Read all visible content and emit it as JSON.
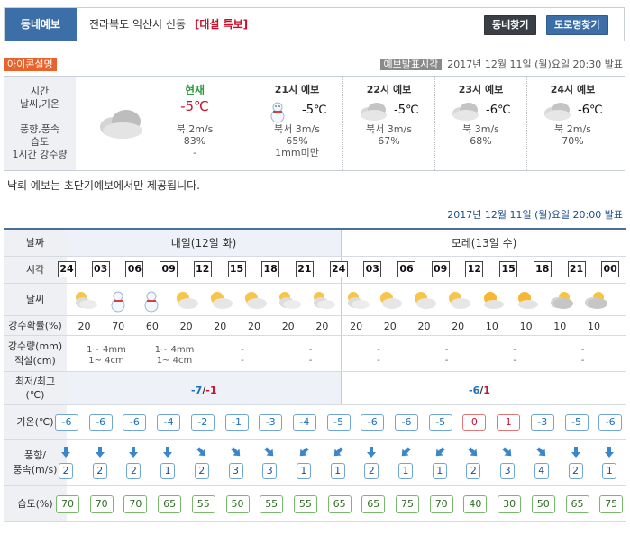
{
  "header": {
    "tab": "동네예보",
    "location": "전라북도 익산시 신동",
    "warning": "[대설 특보]",
    "btn_find": "동네찾기",
    "btn_road": "도로명찾기"
  },
  "icon_help": "아이콘설명",
  "issue": {
    "label": "예보발표시각",
    "time": "2017년 12월 11일 (월)요일 20:30 발표"
  },
  "current": {
    "labels": [
      "시간",
      "날씨,기온",
      "",
      "풍향,풍속",
      "습도",
      "1시간 강수량"
    ],
    "now": {
      "title": "현재",
      "temp": "-5℃",
      "wind": "북 2m/s",
      "humidity": "83%",
      "rain": "-"
    },
    "forecasts": [
      {
        "title": "21시 예보",
        "temp": "-5℃",
        "wind": "북서 3m/s",
        "humidity": "65%",
        "rain": "1mm미만",
        "icon": "snowman-icon"
      },
      {
        "title": "22시 예보",
        "temp": "-5℃",
        "wind": "북서 3m/s",
        "humidity": "67%",
        "rain": "",
        "icon": "cloud-icon"
      },
      {
        "title": "23시 예보",
        "temp": "-6℃",
        "wind": "북 3m/s",
        "humidity": "68%",
        "rain": "",
        "icon": "cloud-icon"
      },
      {
        "title": "24시 예보",
        "temp": "-6℃",
        "wind": "북 2m/s",
        "humidity": "70%",
        "rain": "",
        "icon": "cloud-icon"
      }
    ]
  },
  "note": "낙뢰 예보는 초단기예보에서만 제공됩니다.",
  "table_date": "2017년 12월 11일 (월)요일 20:00 발표",
  "table": {
    "labels": {
      "date": "날짜",
      "time": "시각",
      "weather": "날씨",
      "pop": "강수확률(%)",
      "rain1": "강수량(mm)",
      "rain2": "적설(cm)",
      "mm1": "최저/최고",
      "mm2": "(℃)",
      "temp": "기온(℃)",
      "wind1": "풍향/",
      "wind2": "풍속(m/s)",
      "hum": "습도(%)"
    },
    "dayA": "내일(12일 화)",
    "dayB": "모레(13일 수)",
    "hours": [
      "24",
      "03",
      "06",
      "09",
      "12",
      "15",
      "18",
      "21",
      "24",
      "03",
      "06",
      "09",
      "12",
      "15",
      "18",
      "21",
      "00"
    ],
    "icons": [
      "partly-cloudy-icon",
      "snowman-icon",
      "snowman-icon",
      "partly-sunny-icon",
      "partly-sunny-icon",
      "partly-sunny-icon",
      "partly-cloudy-icon",
      "partly-cloudy-icon",
      "partly-cloudy-icon",
      "partly-sunny-icon",
      "partly-sunny-icon",
      "partly-sunny-icon",
      "sun-cloud-icon",
      "sun-cloud-icon",
      "cloud-icon",
      "cloud-icon"
    ],
    "pop": [
      "20",
      "70",
      "60",
      "20",
      "20",
      "20",
      "20",
      "20",
      "20",
      "20",
      "20",
      "20",
      "10",
      "10",
      "10",
      "10"
    ],
    "rain": [
      {
        "a": "1~ 4mm",
        "b": "1~ 4cm"
      },
      {
        "a": "1~ 4mm",
        "b": "1~ 4cm"
      },
      {
        "a": "-",
        "b": "-"
      },
      {
        "a": "-",
        "b": "-"
      },
      {
        "a": "-",
        "b": "-"
      },
      {
        "a": "-",
        "b": "-"
      },
      {
        "a": "-",
        "b": "-"
      },
      {
        "a": "-",
        "b": "-"
      }
    ],
    "minmaxA": {
      "min": "-7",
      "sep": "/",
      "max": "-1"
    },
    "minmaxB": {
      "min": "-6",
      "sep": "/",
      "max": "1"
    },
    "temps": [
      "-6",
      "-6",
      "-6",
      "-4",
      "-2",
      "-1",
      "-3",
      "-4",
      "-5",
      "-6",
      "-6",
      "-5",
      "0",
      "1",
      "-3",
      "-5",
      "-6"
    ],
    "winds": [
      "2",
      "2",
      "2",
      "1",
      "2",
      "3",
      "3",
      "1",
      "1",
      "2",
      "1",
      "1",
      "2",
      "3",
      "4",
      "2",
      "1"
    ],
    "wind_dirs": [
      0,
      0,
      0,
      0,
      -45,
      -45,
      -45,
      45,
      45,
      0,
      45,
      45,
      -45,
      -45,
      -45,
      0,
      0
    ],
    "humidity": [
      "70",
      "70",
      "70",
      "65",
      "55",
      "50",
      "55",
      "55",
      "65",
      "65",
      "75",
      "70",
      "40",
      "30",
      "50",
      "65",
      "75"
    ]
  }
}
